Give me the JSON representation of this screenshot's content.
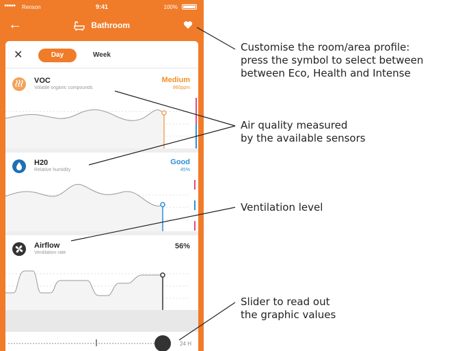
{
  "status_bar": {
    "carrier": "Renson",
    "time": "9:41",
    "battery": "100%"
  },
  "header": {
    "title": "Bathroom"
  },
  "tabs": {
    "day": "Day",
    "week": "Week"
  },
  "sensors": [
    {
      "name": "VOC",
      "subtitle": "Volatile organic compounds",
      "status": "Medium",
      "value": "960ppm",
      "status_color": "#f0922a",
      "icon_color": "#f3a35a",
      "icon": "voc-icon"
    },
    {
      "name": "H20",
      "subtitle": "Relative humidity",
      "status": "Good",
      "value": "45%",
      "status_color": "#2b8fd8",
      "icon_color": "#1f6fb3",
      "icon": "water-drop-icon"
    },
    {
      "name": "Airflow",
      "subtitle": "Ventilation rate",
      "status": "56%",
      "value": "",
      "status_color": "#333333",
      "icon_color": "#333333",
      "icon": "fan-icon"
    }
  ],
  "slider": {
    "label": "24 H"
  },
  "annotations": {
    "profile": [
      "Customise the room/area profile:",
      "press the symbol to select between",
      "between Eco, Health and Intense"
    ],
    "air_quality": [
      "Air quality measured",
      "by the available sensors"
    ],
    "ventilation": [
      "Ventilation level"
    ],
    "slider_note": [
      "Slider to read out",
      "the graphic values"
    ]
  },
  "colors": {
    "accent": "#f07c2a",
    "voc_line": "#f3a35a",
    "h2o_line": "#2b8fd8",
    "airflow_line": "#333333"
  }
}
